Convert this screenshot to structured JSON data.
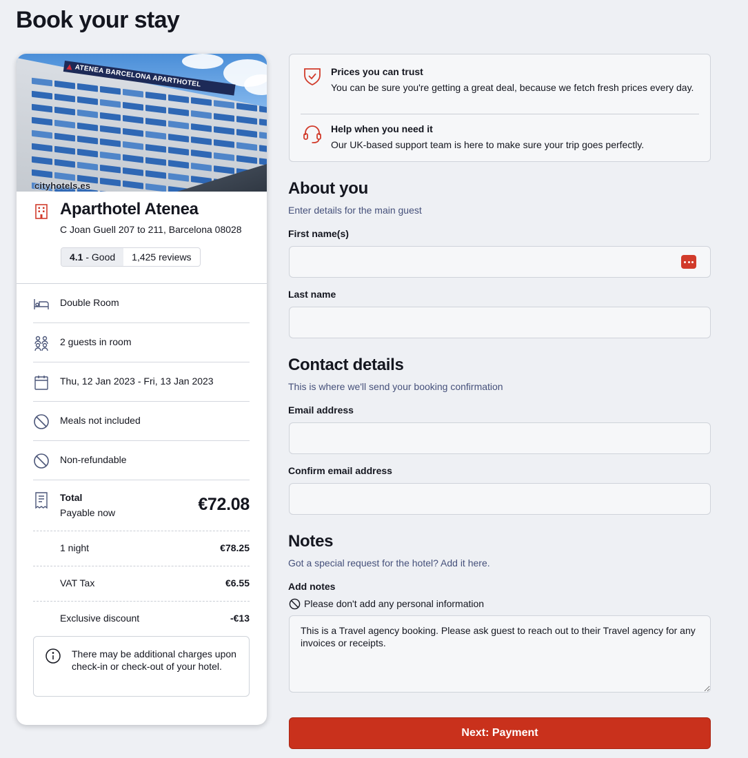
{
  "page": {
    "title": "Book your stay"
  },
  "colors": {
    "accent": "#c9311c",
    "icon_red": "#d13b2b",
    "muted_text": "#45507a"
  },
  "hotel": {
    "photo_watermark": "cityhotels.es",
    "sign_text": "ATENEA BARCELONA APARTHOTEL",
    "name": "Aparthotel Atenea",
    "address": "C Joan Guell 207 to 211, Barcelona 08028",
    "rating_score": "4.1",
    "rating_word": " - Good",
    "reviews": "1,425 reviews"
  },
  "stay_details": [
    {
      "icon": "bed-icon",
      "label": "Double Room"
    },
    {
      "icon": "guests-icon",
      "label": "2 guests in room"
    },
    {
      "icon": "calendar-icon",
      "label": "Thu, 12 Jan 2023 - Fri, 13 Jan 2023"
    },
    {
      "icon": "no-meals-icon",
      "label": "Meals not included"
    },
    {
      "icon": "non-refundable-icon",
      "label": "Non-refundable"
    }
  ],
  "price": {
    "total_label": "Total",
    "payable_label": "Payable now",
    "total": "€72.08",
    "lines": [
      {
        "label": "1 night",
        "amount": "€78.25"
      },
      {
        "label": "VAT Tax",
        "amount": "€6.55"
      },
      {
        "label": "Exclusive discount",
        "amount": "-€13"
      }
    ]
  },
  "charges_note": "There may be additional charges upon check-in or check-out of your hotel.",
  "trust": [
    {
      "icon": "shield-check-icon",
      "title": "Prices you can trust",
      "desc": "You can be sure you're getting a great deal, because we fetch fresh prices every day."
    },
    {
      "icon": "headset-icon",
      "title": "Help when you need it",
      "desc": "Our UK-based support team is here to make sure your trip goes perfectly."
    }
  ],
  "about": {
    "title": "About you",
    "subtitle": "Enter details for the main guest",
    "first_name_label": "First name(s)",
    "first_name_value": "",
    "last_name_label": "Last name",
    "last_name_value": ""
  },
  "contact": {
    "title": "Contact details",
    "subtitle": "This is where we'll send your booking confirmation",
    "email_label": "Email address",
    "email_value": "",
    "confirm_label": "Confirm email address",
    "confirm_value": ""
  },
  "notes": {
    "title": "Notes",
    "subtitle": "Got a special request for the hotel? Add it here.",
    "label": "Add notes",
    "privacy": "Please don't add any personal information",
    "value": "This is a Travel agency booking. Please ask guest to reach out to their Travel agency for any invoices or receipts."
  },
  "next_button": "Next: Payment"
}
